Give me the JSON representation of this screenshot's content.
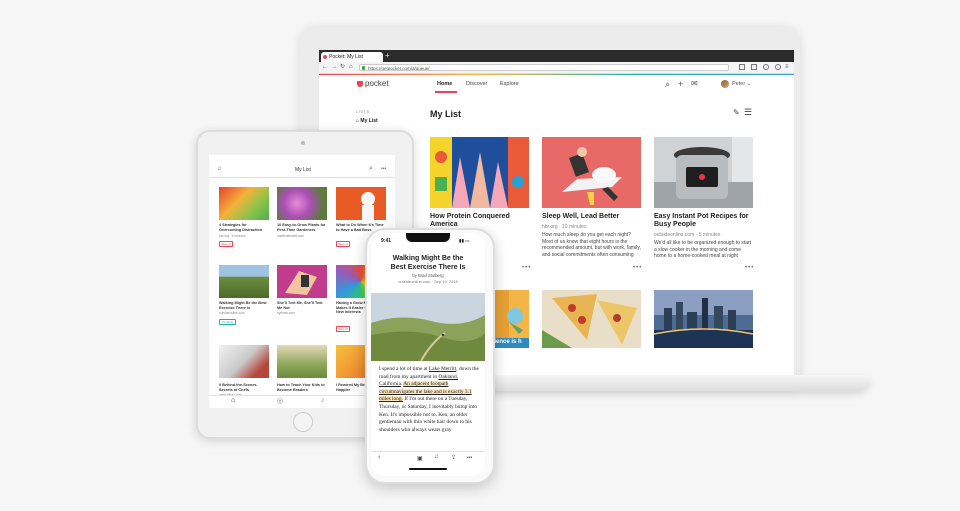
{
  "laptop": {
    "browser": {
      "tab_title": "Pocket: My List",
      "new_tab": "+",
      "url": "https://getpocket.com/a/queue/"
    },
    "app": {
      "logo_text": "pocket",
      "nav": [
        "Home",
        "Discover",
        "Explore"
      ],
      "user_name": "Peter",
      "sidebar_label": "LISTS",
      "sidebar_item": "My List",
      "page_title": "My List"
    },
    "cards": [
      {
        "title": "How Protein Conquered America",
        "source": "",
        "excerpt": ""
      },
      {
        "title": "Sleep Well, Lead Better",
        "source": "hbr.org · 10 minutes",
        "excerpt": "How much sleep do you get each night? Most of us know that eight hours is the recommended amount, but with work, family, and social commitments often consuming"
      },
      {
        "title": "Easy Instant Pot Recipes for Busy People",
        "source": "outsideonline.com · 5 minutes",
        "excerpt": "We'd all like to be organized enough to start a slow cooker in the morning and come home to a home-cooked meal at night"
      },
      {
        "title": "",
        "source": "",
        "excerpt": ""
      },
      {
        "title": "",
        "source": "",
        "excerpt": ""
      },
      {
        "title": "",
        "source": "",
        "excerpt": ""
      }
    ],
    "more_glyph": "•••",
    "partial_image_text": "cience is h"
  },
  "ipad": {
    "header_title": "My List",
    "more": "•••",
    "cards": [
      {
        "title": "4 Strategies for Overcoming Distraction",
        "source": "hbr.org · 6 minutes",
        "badge": "Best of"
      },
      {
        "title": "10 Easy-to-Grow Plants for First-Time Gardeners",
        "source": "marthastewart.com",
        "badge": ""
      },
      {
        "title": "What to Do When It's Time to Have a Bad Boss",
        "source": "wired.com",
        "badge": "Best of"
      },
      {
        "title": "Walking Might Be the Best Exercise There Is",
        "source": "outsideonline.com",
        "badge": "Trending"
      },
      {
        "title": "She'll Text Me, She'll Text Me Not",
        "source": "nytimes.com",
        "badge": ""
      },
      {
        "title": "Having a Grow Mindset Makes It Easier to Develop New Interests",
        "source": "",
        "badge": "Best of"
      },
      {
        "title": "9 Behind-the-Scenes Secrets of Chefs",
        "source": "mentalfloss.com",
        "badge": ""
      },
      {
        "title": "How to Teach Your Kids to Become Readers",
        "source": "",
        "badge": ""
      },
      {
        "title": "I Rewired My Brain to Be Happier",
        "source": "",
        "badge": ""
      }
    ]
  },
  "iphone": {
    "time": "9:41",
    "article_title": "Walking Might Be the Best Exercise There Is",
    "byline": "by Brad Stulberg",
    "byline_source": "outsideonline.com · Sep 10, 2018",
    "paragraph_1": "I spend a lot of time at ",
    "link_1": "Lake Merritt",
    "paragraph_2": ", down the road from my apartment in ",
    "link_2": "Oakland, California",
    "paragraph_3": ". ",
    "highlight": "An adjacent footpath circumnavigates the lake and is exactly 3.1 miles long.",
    "paragraph_4": " If I'm out there on a Tuesday, Thursday, or Saturday, I inevitably bump into Ken. It's impossible not to. Ken, an older gentleman with thin white hair down to his shoulders who always wears gray",
    "more": "•••"
  },
  "colors": {
    "pocket_red": "#ef4056",
    "highlight": "#fbe6b8",
    "link": "#333333"
  }
}
